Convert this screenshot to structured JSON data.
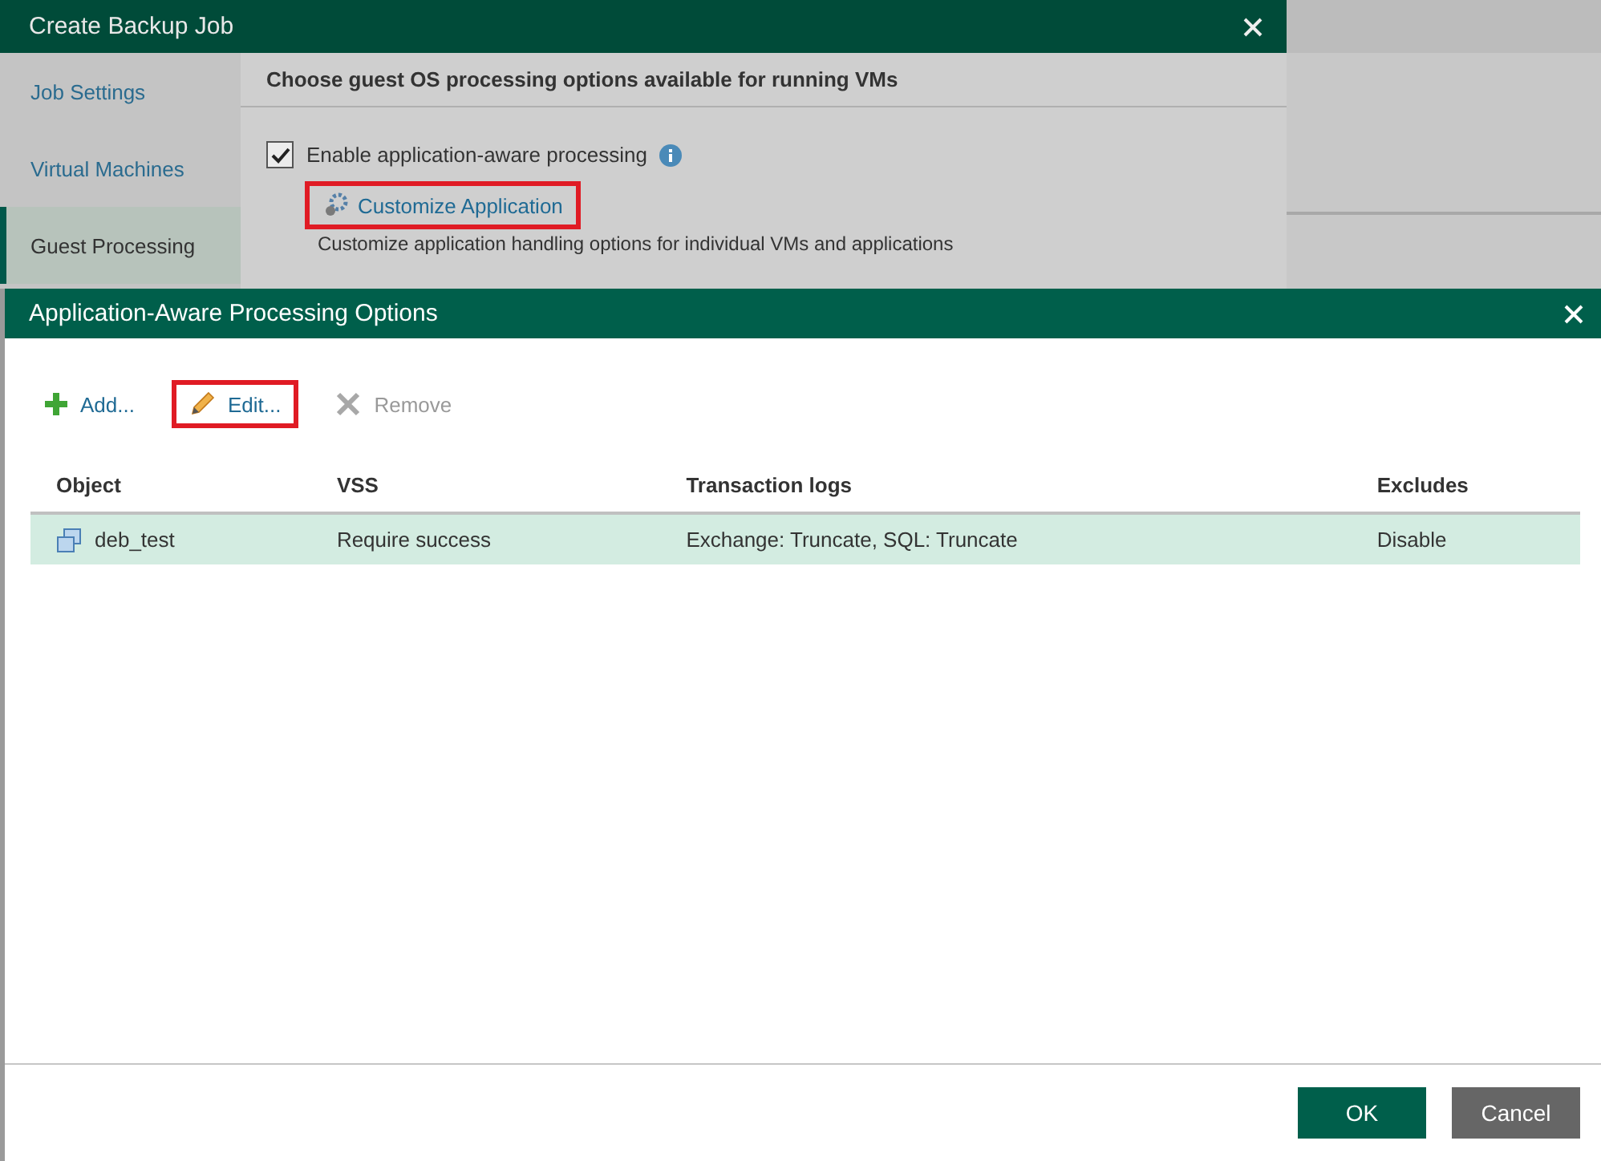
{
  "backup_window": {
    "title": "Create Backup Job",
    "sidebar": [
      {
        "label": "Job Settings",
        "selected": false
      },
      {
        "label": "Virtual Machines",
        "selected": false
      },
      {
        "label": "Guest Processing",
        "selected": true
      }
    ],
    "heading": "Choose guest OS processing options available for running VMs",
    "enable_checkbox": {
      "label": "Enable application-aware processing",
      "checked": true
    },
    "customize_link": {
      "label": "Customize Application",
      "highlighted": true
    },
    "description": "Customize application handling options for individual VMs and applications"
  },
  "dialog": {
    "title": "Application-Aware Processing Options",
    "toolbar": [
      {
        "kind": "add",
        "label": "Add...",
        "disabled": false,
        "highlighted": false
      },
      {
        "kind": "edit",
        "label": "Edit...",
        "disabled": false,
        "highlighted": true
      },
      {
        "kind": "remove",
        "label": "Remove",
        "disabled": true,
        "highlighted": false
      }
    ],
    "table": {
      "columns": [
        "Object",
        "VSS",
        "Transaction logs",
        "Excludes"
      ],
      "rows": [
        {
          "cells": [
            "deb_test",
            "Require success",
            "Exchange: Truncate, SQL: Truncate",
            "Disable"
          ],
          "selected": true
        }
      ]
    },
    "buttons": [
      {
        "kind": "primary",
        "label": "OK"
      },
      {
        "kind": "secondary",
        "label": "Cancel"
      }
    ]
  }
}
